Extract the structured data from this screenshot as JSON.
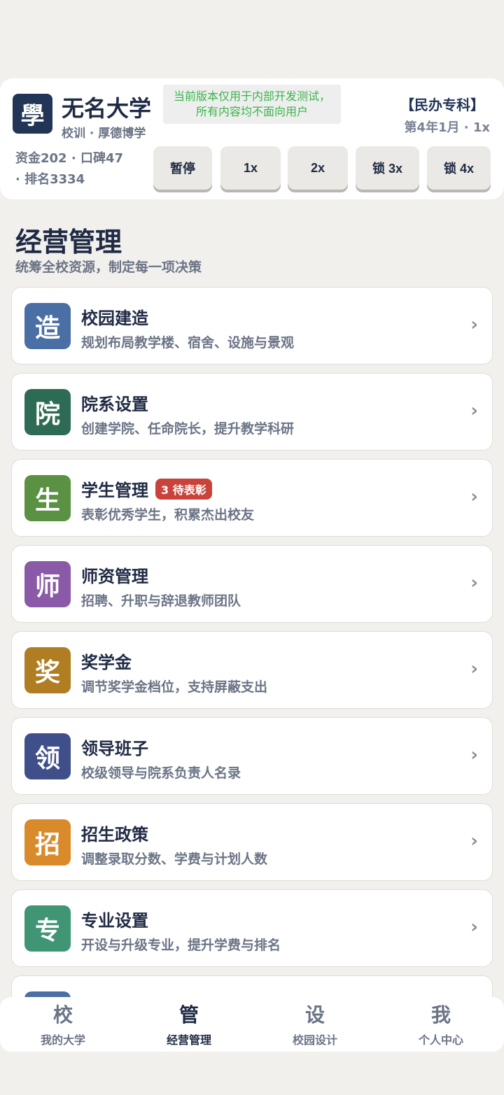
{
  "header": {
    "logo_glyph": "學",
    "name": "无名大学",
    "motto": "校训 · 厚德博学",
    "notice_line1": "当前版本仅用于内部开发测试，",
    "notice_line2": "所有内容均不面向用户",
    "school_type": "【民办专科】",
    "date_speed": "第4年1月 · 1x",
    "stats_line1": "资金202 · 口碑47",
    "stats_line2": "· 排名3334",
    "controls": [
      "暂停",
      "1x",
      "2x",
      "锁 3x",
      "锁 4x"
    ]
  },
  "section": {
    "title": "经营管理",
    "subtitle": "统筹全校资源，制定每一项决策"
  },
  "menu": [
    {
      "glyph": "造",
      "color": "#4a6fa5",
      "title": "校园建造",
      "desc": "规划布局教学楼、宿舍、设施与景观",
      "badge": ""
    },
    {
      "glyph": "院",
      "color": "#2e6b54",
      "title": "院系设置",
      "desc": "创建学院、任命院长，提升教学科研",
      "badge": ""
    },
    {
      "glyph": "生",
      "color": "#5a9142",
      "title": "学生管理",
      "desc": "表彰优秀学生，积累杰出校友",
      "badge": "3 待表彰"
    },
    {
      "glyph": "师",
      "color": "#8a5aa8",
      "title": "师资管理",
      "desc": "招聘、升职与辞退教师团队",
      "badge": ""
    },
    {
      "glyph": "奖",
      "color": "#b07d22",
      "title": "奖学金",
      "desc": "调节奖学金档位，支持屏蔽支出",
      "badge": ""
    },
    {
      "glyph": "领",
      "color": "#3f4f8a",
      "title": "领导班子",
      "desc": "校级领导与院系负责人名录",
      "badge": ""
    },
    {
      "glyph": "招",
      "color": "#d98a2b",
      "title": "招生政策",
      "desc": "调整录取分数、学费与计划人数",
      "badge": ""
    },
    {
      "glyph": "专",
      "color": "#3f9574",
      "title": "专业设置",
      "desc": "开设与升级专业，提升学费与排名",
      "badge": ""
    }
  ],
  "menu_partial_color": "#4a6fa5",
  "chevron": "›",
  "nav": [
    {
      "glyph": "校",
      "label": "我的大学",
      "active": false
    },
    {
      "glyph": "管",
      "label": "经营管理",
      "active": true
    },
    {
      "glyph": "设",
      "label": "校园设计",
      "active": false
    },
    {
      "glyph": "我",
      "label": "个人中心",
      "active": false
    }
  ]
}
